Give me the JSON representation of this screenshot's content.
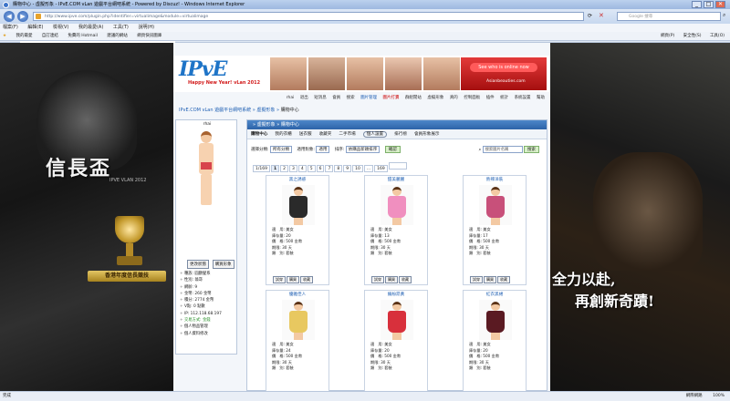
{
  "window": {
    "title": "購物中心 - 虛擬形象 - IPvE.COM vLan 遊戲平台網吧系統 - Powered by Discuz! - Windows Internet Explorer",
    "minimize": "_",
    "maximize": "□",
    "close": "✕"
  },
  "address": {
    "url": "http://www.ipve.com/plugin.php?identifier=virtualimage&module=virtualimage",
    "search_placeholder": "Google 搜尋"
  },
  "menu": [
    "檔案(F)",
    "編輯(E)",
    "檢視(V)",
    "我的最愛(A)",
    "工具(T)",
    "說明(H)"
  ],
  "favorites": {
    "items": [
      "我的最愛",
      "自訂連結",
      "免費的 Hotmail",
      "建議的網站",
      "網頁快訊圖庫"
    ],
    "tab": "購物中心 - 虛擬形象 - IPvE.COM vLan 遊戲平台網吧...",
    "right": [
      "網頁(P)",
      "安全性(S)",
      "工具(O)"
    ]
  },
  "status": {
    "left": "完成",
    "zone": "網際網路",
    "zoom": "100%"
  },
  "art": {
    "left_logo": "信長盃",
    "left_sub": "IPVE VLAN 2012",
    "ribbon": "香港年度信長競技",
    "slogan1": "全力以赴,",
    "slogan2": "再創新奇蹟!"
  },
  "banner": {
    "logo": "IPvE",
    "happy": "Happy New Year! vLan 2012",
    "ad_button": "See who is online now",
    "ad_site": "Asianbeauties.com"
  },
  "topnav": [
    "rhai",
    "退出",
    "短消息",
    "會員",
    "搜索",
    "圖片管理",
    "圖片打賣",
    "群組閒站",
    "虛擬形象",
    "真的",
    "控制面板",
    "插件",
    "統計",
    "系統設置",
    "幫助"
  ],
  "breadcrumb": {
    "site": "IPvE.COM vLan 遊戲平台網吧系統",
    "section": "虛擬形象",
    "current": "購物中心"
  },
  "sidebar": {
    "username": "rhai",
    "btn_change": "更改狀態",
    "btn_view": "購買形象",
    "info": [
      {
        "label": "種族: 圓顱髮系",
        "cls": ""
      },
      {
        "label": "性別: 翁哥",
        "cls": ""
      },
      {
        "label": "網齡: 9",
        "cls": ""
      },
      {
        "label": "金幣: 260 金幣",
        "cls": ""
      },
      {
        "label": "積分: 2774 金幣",
        "cls": ""
      },
      {
        "label": "V點: 0 點數",
        "cls": ""
      },
      {
        "label": "IP: 112.118.68.197",
        "cls": ""
      },
      {
        "label": "交易方式: 金錢",
        "cls": "ok"
      },
      {
        "label": "個人物品管理",
        "cls": ""
      },
      {
        "label": "個人資料修改",
        "cls": ""
      }
    ]
  },
  "main": {
    "header": "» 虛擬形象 » 購物中心",
    "tabs": [
      {
        "label": "購物中心",
        "style": "active"
      },
      {
        "label": "我的衣櫃",
        "style": ""
      },
      {
        "label": "送衣服",
        "style": ""
      },
      {
        "label": "收藏夾",
        "style": ""
      },
      {
        "label": "二手市場",
        "style": ""
      },
      {
        "label": "個人設置",
        "style": "circled"
      },
      {
        "label": "排行榜",
        "style": ""
      },
      {
        "label": "會員形象展示",
        "style": ""
      }
    ],
    "filter": {
      "label1": "選擇分類:",
      "val1": "所有分類",
      "label2": "適用對象:",
      "val2": "適用",
      "label3": "排序:",
      "val3": "依購品新穎排序",
      "confirm": "確認"
    },
    "image_search": {
      "placeholder": "搜索圖片名稱",
      "button": "搜索"
    },
    "pager": {
      "items": [
        "1/169",
        "1",
        "2",
        "3",
        "4",
        "5",
        "6",
        "7",
        "8",
        "9",
        "10",
        "...",
        "169"
      ],
      "current": "1"
    }
  },
  "products": [
    {
      "name": "黑之誘惑",
      "color": "#2a2a2a",
      "fit": "適　用: 美女",
      "stock": "庫存量: 20",
      "price": "價　格: 500 金幣",
      "days": "期限: 30 天",
      "type": "類　別: 套裝"
    },
    {
      "name": "甜美麗麗",
      "color": "#f08fbf",
      "fit": "適　用: 美女",
      "stock": "庫存量: 13",
      "price": "價　格: 500 金幣",
      "days": "期限: 30 天",
      "type": "類　別: 套裝"
    },
    {
      "name": "熱辣洋裝",
      "color": "#c8507a",
      "fit": "適　用: 美女",
      "stock": "庫存量: 17",
      "price": "價　格: 500 金幣",
      "days": "期限: 30 天",
      "type": "類　別: 套裝"
    },
    {
      "name": "優雅佳人",
      "color": "#e8c860",
      "fit": "適　用: 美女",
      "stock": "庫存量: 24",
      "price": "價　格: 500 金幣",
      "days": "期限: 30 天",
      "type": "類　別: 套裝"
    },
    {
      "name": "繽紛昂黃",
      "color": "#d8303c",
      "fit": "適　用: 美女",
      "stock": "庫存量: 20",
      "price": "價　格: 500 金幣",
      "days": "期限: 30 天",
      "type": "類　別: 套裝"
    },
    {
      "name": "紅衣黑裙",
      "color": "#5a1a22",
      "fit": "適　用: 美女",
      "stock": "庫存量: 20",
      "price": "價　格: 500 金幣",
      "days": "期限: 30 天",
      "type": "類　別: 套裝"
    }
  ],
  "card_buttons": [
    "試穿",
    "購買",
    "收藏"
  ]
}
